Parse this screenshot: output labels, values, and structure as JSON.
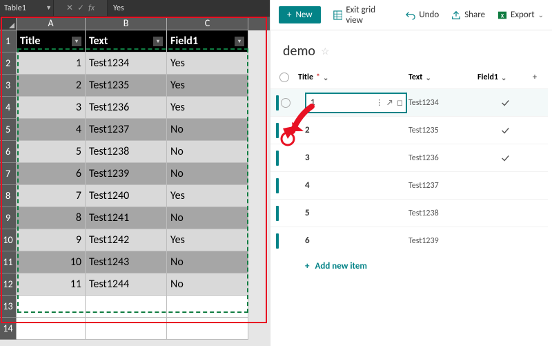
{
  "excel": {
    "name_box": "Table1",
    "fx_value": "Yes",
    "columns": [
      "A",
      "B",
      "C"
    ],
    "table_headers": {
      "title": "Title",
      "text": "Text",
      "field1": "Field1"
    },
    "rows": [
      {
        "n": "1",
        "title": "1",
        "text": "Test1234",
        "field1": "Yes"
      },
      {
        "n": "2",
        "title": "2",
        "text": "Test1235",
        "field1": "Yes"
      },
      {
        "n": "3",
        "title": "3",
        "text": "Test1236",
        "field1": "Yes"
      },
      {
        "n": "4",
        "title": "4",
        "text": "Test1237",
        "field1": "No"
      },
      {
        "n": "5",
        "title": "5",
        "text": "Test1238",
        "field1": "No"
      },
      {
        "n": "6",
        "title": "6",
        "text": "Test1239",
        "field1": "No"
      },
      {
        "n": "7",
        "title": "7",
        "text": "Test1240",
        "field1": "Yes"
      },
      {
        "n": "8",
        "title": "8",
        "text": "Test1241",
        "field1": "No"
      },
      {
        "n": "9",
        "title": "9",
        "text": "Test1242",
        "field1": "Yes"
      },
      {
        "n": "10",
        "title": "10",
        "text": "Test1243",
        "field1": "No"
      },
      {
        "n": "11",
        "title": "11",
        "text": "Test1244",
        "field1": "No"
      }
    ],
    "empty_rows": [
      "13",
      "14"
    ]
  },
  "sp": {
    "cmd": {
      "new": "New",
      "exit": "Exit grid view",
      "undo": "Undo",
      "share": "Share",
      "export": "Export"
    },
    "list_title": "demo",
    "cols": {
      "title": "Title",
      "text": "Text",
      "field1": "Field1"
    },
    "rows": [
      {
        "title": "1",
        "text": "Test1234",
        "check": true,
        "selected": true
      },
      {
        "title": "2",
        "text": "Test1235",
        "check": true
      },
      {
        "title": "3",
        "text": "Test1236",
        "check": true
      },
      {
        "title": "4",
        "text": "Test1237",
        "check": false
      },
      {
        "title": "5",
        "text": "Test1238",
        "check": false
      },
      {
        "title": "6",
        "text": "Test1239",
        "check": false
      }
    ],
    "add_new": "Add new item"
  }
}
